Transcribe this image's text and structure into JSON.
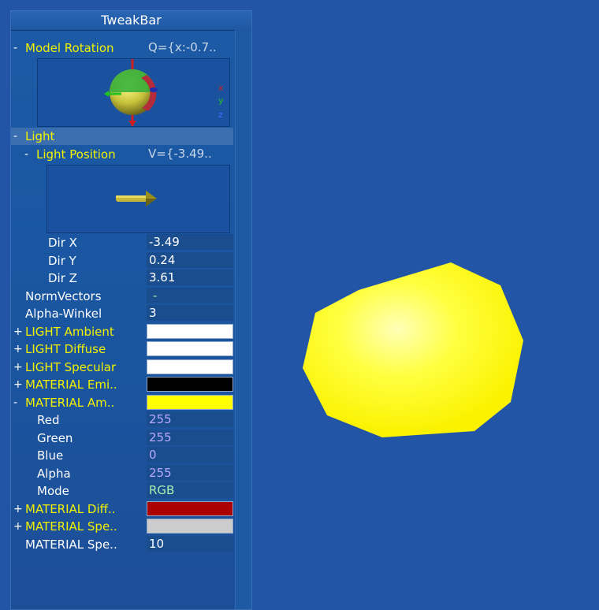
{
  "tweakbar": {
    "title": "TweakBar",
    "model_rotation": {
      "label": "Model Rotation",
      "value": "Q={x:-0.7..",
      "toggle": "-",
      "axis_x": "x",
      "axis_y": "y",
      "axis_z": "z"
    },
    "light": {
      "label": "Light",
      "toggle": "-"
    },
    "light_position": {
      "label": "Light Position",
      "value": "V={-3.49..",
      "toggle": "-"
    },
    "dir_x": {
      "label": "Dir X",
      "value": "-3.49"
    },
    "dir_y": {
      "label": "Dir Y",
      "value": "0.24"
    },
    "dir_z": {
      "label": "Dir Z",
      "value": "3.61"
    },
    "norm_vectors": {
      "label": "NormVectors",
      "value": "-"
    },
    "alpha_winkel": {
      "label": "Alpha-Winkel",
      "value": "3"
    },
    "light_ambient": {
      "label": "LIGHT Ambient",
      "toggle": "+",
      "color": "#ffffff"
    },
    "light_diffuse": {
      "label": "LIGHT Diffuse",
      "toggle": "+",
      "color": "#ffffff"
    },
    "light_specular": {
      "label": "LIGHT Specular",
      "toggle": "+",
      "color": "#ffffff"
    },
    "material_emission": {
      "label": "MATERIAL Emi..",
      "toggle": "+",
      "color": "#000000"
    },
    "material_ambient": {
      "label": "MATERIAL Am..",
      "toggle": "-",
      "color": "#ffff00"
    },
    "red": {
      "label": "Red",
      "value": "255"
    },
    "green": {
      "label": "Green",
      "value": "255"
    },
    "blue": {
      "label": "Blue",
      "value": "0"
    },
    "alpha": {
      "label": "Alpha",
      "value": "255"
    },
    "mode": {
      "label": "Mode",
      "value": "RGB"
    },
    "material_diffuse": {
      "label": "MATERIAL Diff..",
      "toggle": "+",
      "color": "#aa0000"
    },
    "material_specular": {
      "label": "MATERIAL Spe..",
      "toggle": "+",
      "color": "#cccccc"
    },
    "material_shininess": {
      "label": "MATERIAL Spe..",
      "value": "10"
    }
  },
  "colors": {
    "background": "#2255a6",
    "object": "#ffff00"
  }
}
